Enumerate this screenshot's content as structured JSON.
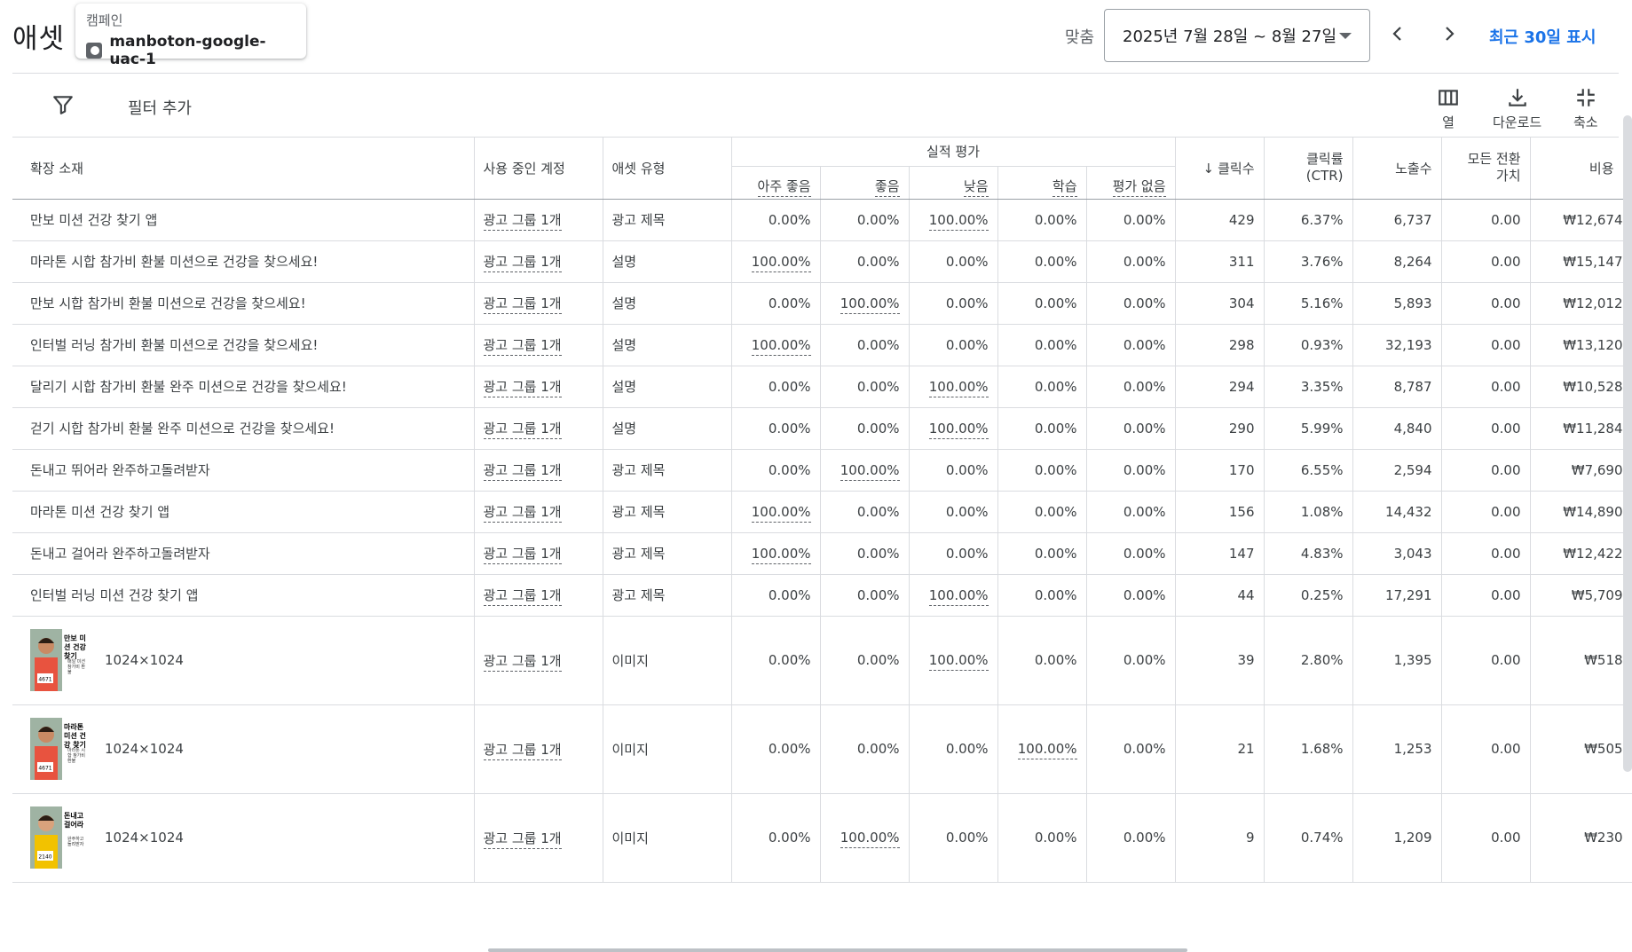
{
  "page": {
    "title": "애셋"
  },
  "campaign": {
    "label": "캠페인",
    "name": "manboton-google-uac-1"
  },
  "date": {
    "match_label": "맞춤",
    "range": "2025년 7월 28일 ~ 8월 27일",
    "recent_link": "최근 30일 표시"
  },
  "toolbar": {
    "filter_label": "필터 추가",
    "columns_label": "열",
    "download_label": "다운로드",
    "collapse_label": "축소"
  },
  "columns": {
    "asset": "확장 소재",
    "account": "사용 중인 계정",
    "type": "애셋 유형",
    "perf_group": "실적 평가",
    "perf_best": "아주 좋음",
    "perf_good": "좋음",
    "perf_low": "낮음",
    "perf_learning": "학습",
    "perf_none": "평가 없음",
    "clicks": "클릭수",
    "ctr_line1": "클릭률",
    "ctr_line2": "(CTR)",
    "impressions": "노출수",
    "conv_line1": "모든 전환",
    "conv_line2": "가치",
    "cost": "비용"
  },
  "rows": [
    {
      "asset": "만보 미션 건강 찾기 앱",
      "account": "광고 그룹 1개",
      "type": "광고 제목",
      "best": "0.00%",
      "good": "0.00%",
      "low": "100.00%",
      "learning": "0.00%",
      "none": "0.00%",
      "clicks": "429",
      "ctr": "6.37%",
      "impr": "6,737",
      "conv": "0.00",
      "cost": "₩12,674"
    },
    {
      "asset": "마라톤 시합 참가비 환불 미션으로 건강을 찾으세요!",
      "account": "광고 그룹 1개",
      "type": "설명",
      "best": "100.00%",
      "good": "0.00%",
      "low": "0.00%",
      "learning": "0.00%",
      "none": "0.00%",
      "clicks": "311",
      "ctr": "3.76%",
      "impr": "8,264",
      "conv": "0.00",
      "cost": "₩15,147"
    },
    {
      "asset": "만보 시합 참가비 환불 미션으로 건강을 찾으세요!",
      "account": "광고 그룹 1개",
      "type": "설명",
      "best": "0.00%",
      "good": "100.00%",
      "low": "0.00%",
      "learning": "0.00%",
      "none": "0.00%",
      "clicks": "304",
      "ctr": "5.16%",
      "impr": "5,893",
      "conv": "0.00",
      "cost": "₩12,012"
    },
    {
      "asset": "인터벌 러닝 참가비 환불 미션으로 건강을 찾으세요!",
      "account": "광고 그룹 1개",
      "type": "설명",
      "best": "100.00%",
      "good": "0.00%",
      "low": "0.00%",
      "learning": "0.00%",
      "none": "0.00%",
      "clicks": "298",
      "ctr": "0.93%",
      "impr": "32,193",
      "conv": "0.00",
      "cost": "₩13,120"
    },
    {
      "asset": "달리기 시합 참가비 환불 완주 미션으로 건강을 찾으세요!",
      "account": "광고 그룹 1개",
      "type": "설명",
      "best": "0.00%",
      "good": "0.00%",
      "low": "100.00%",
      "learning": "0.00%",
      "none": "0.00%",
      "clicks": "294",
      "ctr": "3.35%",
      "impr": "8,787",
      "conv": "0.00",
      "cost": "₩10,528"
    },
    {
      "asset": "걷기 시합 참가비 환불 완주 미션으로 건강을 찾으세요!",
      "account": "광고 그룹 1개",
      "type": "설명",
      "best": "0.00%",
      "good": "0.00%",
      "low": "100.00%",
      "learning": "0.00%",
      "none": "0.00%",
      "clicks": "290",
      "ctr": "5.99%",
      "impr": "4,840",
      "conv": "0.00",
      "cost": "₩11,284"
    },
    {
      "asset": "돈내고 뛰어라 완주하고돌려받자",
      "account": "광고 그룹 1개",
      "type": "광고 제목",
      "best": "0.00%",
      "good": "100.00%",
      "low": "0.00%",
      "learning": "0.00%",
      "none": "0.00%",
      "clicks": "170",
      "ctr": "6.55%",
      "impr": "2,594",
      "conv": "0.00",
      "cost": "₩7,690"
    },
    {
      "asset": "마라톤 미션 건강 찾기 앱",
      "account": "광고 그룹 1개",
      "type": "광고 제목",
      "best": "100.00%",
      "good": "0.00%",
      "low": "0.00%",
      "learning": "0.00%",
      "none": "0.00%",
      "clicks": "156",
      "ctr": "1.08%",
      "impr": "14,432",
      "conv": "0.00",
      "cost": "₩14,890"
    },
    {
      "asset": "돈내고 걸어라 완주하고돌려받자",
      "account": "광고 그룹 1개",
      "type": "광고 제목",
      "best": "100.00%",
      "good": "0.00%",
      "low": "0.00%",
      "learning": "0.00%",
      "none": "0.00%",
      "clicks": "147",
      "ctr": "4.83%",
      "impr": "3,043",
      "conv": "0.00",
      "cost": "₩12,422"
    },
    {
      "asset": "인터벌 러닝 미션 건강 찾기 앱",
      "account": "광고 그룹 1개",
      "type": "광고 제목",
      "best": "0.00%",
      "good": "0.00%",
      "low": "100.00%",
      "learning": "0.00%",
      "none": "0.00%",
      "clicks": "44",
      "ctr": "0.25%",
      "impr": "17,291",
      "conv": "0.00",
      "cost": "₩5,709"
    }
  ],
  "image_rows": [
    {
      "thumb_title": "만보 미션 건강 찾기",
      "thumb_sub": "매일 미션 참가비 환불",
      "bib": "4671",
      "size": "1024×1024",
      "account": "광고 그룹 1개",
      "type": "이미지",
      "best": "0.00%",
      "good": "0.00%",
      "low": "100.00%",
      "learning": "0.00%",
      "none": "0.00%",
      "clicks": "39",
      "ctr": "2.80%",
      "impr": "1,395",
      "conv": "0.00",
      "cost": "₩518",
      "shirt": "#e8533f",
      "skin": "#c98a64"
    },
    {
      "thumb_title": "마라톤 미션 건강 찾기",
      "thumb_sub": "마라톤 시합 참가비 환불",
      "bib": "4671",
      "size": "1024×1024",
      "account": "광고 그룹 1개",
      "type": "이미지",
      "best": "0.00%",
      "good": "0.00%",
      "low": "0.00%",
      "learning": "100.00%",
      "none": "0.00%",
      "clicks": "21",
      "ctr": "1.68%",
      "impr": "1,253",
      "conv": "0.00",
      "cost": "₩505",
      "shirt": "#e8533f",
      "skin": "#c98a64"
    },
    {
      "thumb_title": "돈내고 걸어라",
      "thumb_sub": "완주하고 돌려받자",
      "bib": "2140",
      "size": "1024×1024",
      "account": "광고 그룹 1개",
      "type": "이미지",
      "best": "0.00%",
      "good": "100.00%",
      "low": "0.00%",
      "learning": "0.00%",
      "none": "0.00%",
      "clicks": "9",
      "ctr": "0.74%",
      "impr": "1,209",
      "conv": "0.00",
      "cost": "₩230",
      "shirt": "#f2c200",
      "skin": "#d9a27c"
    }
  ],
  "colors": {
    "accent": "#1a73e8",
    "border": "#dadce0",
    "text": "#3c4043"
  }
}
